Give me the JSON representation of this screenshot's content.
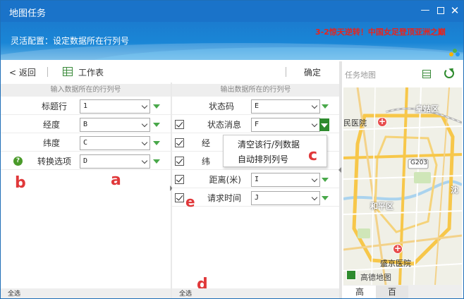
{
  "window": {
    "title": "地图任务",
    "controls": [
      "minimize-icon",
      "maximize-icon",
      "close-icon"
    ]
  },
  "banner": {
    "subtitle": "灵活配置：设定数据所在行列号",
    "news": "3-2惊天逆转！中国女足登顶亚洲之巅"
  },
  "toolbar": {
    "back_label": "< 返回",
    "sheet_label": "工作表",
    "ok_label": "确定"
  },
  "left_panel": {
    "header": "输入数据所在的行列号",
    "rows": [
      {
        "label": "标题行",
        "value": "1"
      },
      {
        "label": "经度",
        "value": "B"
      },
      {
        "label": "纬度",
        "value": "C"
      },
      {
        "label": "转换选项",
        "value": "D"
      }
    ],
    "footer": "全选"
  },
  "mid_panel": {
    "header": "输出数据所在的行列号",
    "rows": [
      {
        "label": "状态码",
        "value": "E",
        "checkbox": false
      },
      {
        "label": "状态消息",
        "value": "F",
        "checkbox": true
      },
      {
        "label": "经",
        "value": "",
        "checkbox": true
      },
      {
        "label": "纬",
        "value": "",
        "checkbox": true
      },
      {
        "label": "距离(米)",
        "value": "I",
        "checkbox": true
      },
      {
        "label": "请求时间",
        "value": "J",
        "checkbox": true
      }
    ],
    "footer": "全选"
  },
  "context_menu": {
    "items": [
      "清空该行/列数据",
      "自动排列列号"
    ]
  },
  "markers": {
    "a": "a",
    "b": "b",
    "c": "c",
    "d": "d",
    "e": "e"
  },
  "map_panel": {
    "title": "任务地图",
    "labels": {
      "huangguqu": "皇姑区",
      "hospital1": "民医院",
      "g203": "G203",
      "shen": "沈",
      "hepingqu": "和平区",
      "hospital2": "盛京医院",
      "provider": "高德地图"
    },
    "tabs": [
      "高",
      "百"
    ]
  },
  "colors": {
    "titlebar": "#1a73c9",
    "accent_green": "#2e8b2e",
    "marker_red": "#e0383a",
    "news_red": "#e8231c"
  }
}
